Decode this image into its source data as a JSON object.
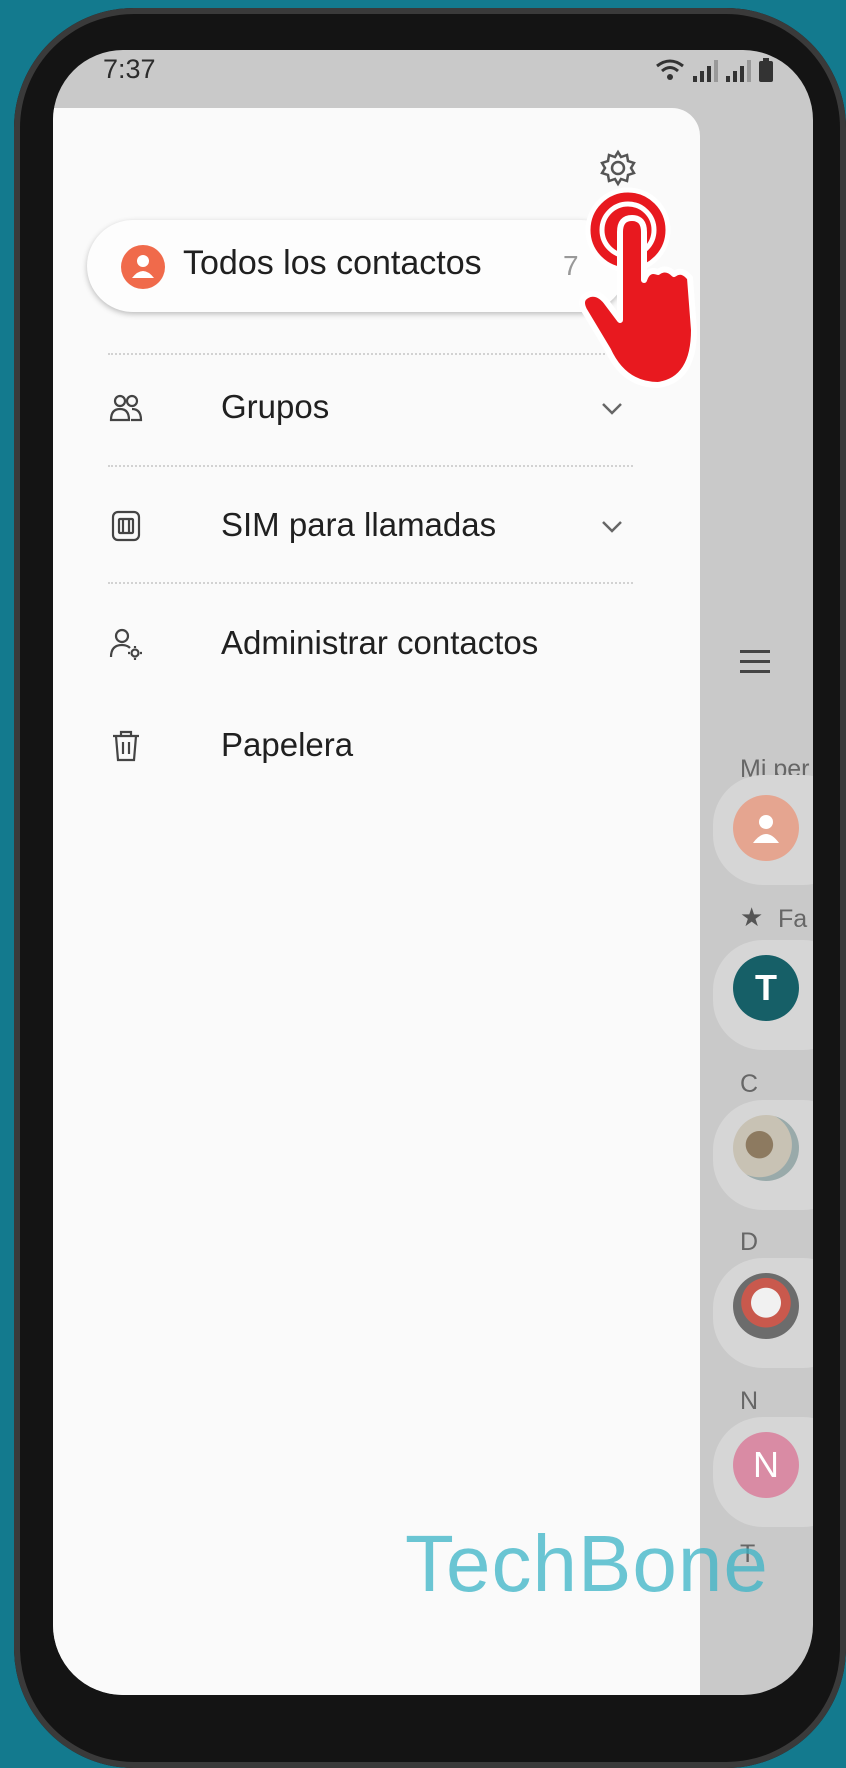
{
  "status_bar": {
    "time": "7:37"
  },
  "background_list": {
    "my_profile_label": "Mi per",
    "favorites_label": "Fa",
    "section_c": "C",
    "section_d": "D",
    "section_n": "N",
    "section_t": "T",
    "avatar_t_letter": "T",
    "avatar_n_letter": "N"
  },
  "drawer": {
    "all_contacts": {
      "label": "Todos los contactos",
      "count": "7"
    },
    "items": [
      {
        "label": "Grupos",
        "icon": "groups-icon",
        "expandable": true
      },
      {
        "label": "SIM para llamadas",
        "icon": "sim-card-icon",
        "expandable": true
      },
      {
        "label": "Administrar contactos",
        "icon": "manage-contacts-icon",
        "expandable": false
      },
      {
        "label": "Papelera",
        "icon": "trash-icon",
        "expandable": false
      }
    ]
  },
  "watermark": {
    "text": "TechBone"
  },
  "colors": {
    "background": "#137a8e",
    "accent_avatar": "#f06a4b",
    "tap_indicator": "#e8191f",
    "watermark": "#3bb4c7"
  }
}
